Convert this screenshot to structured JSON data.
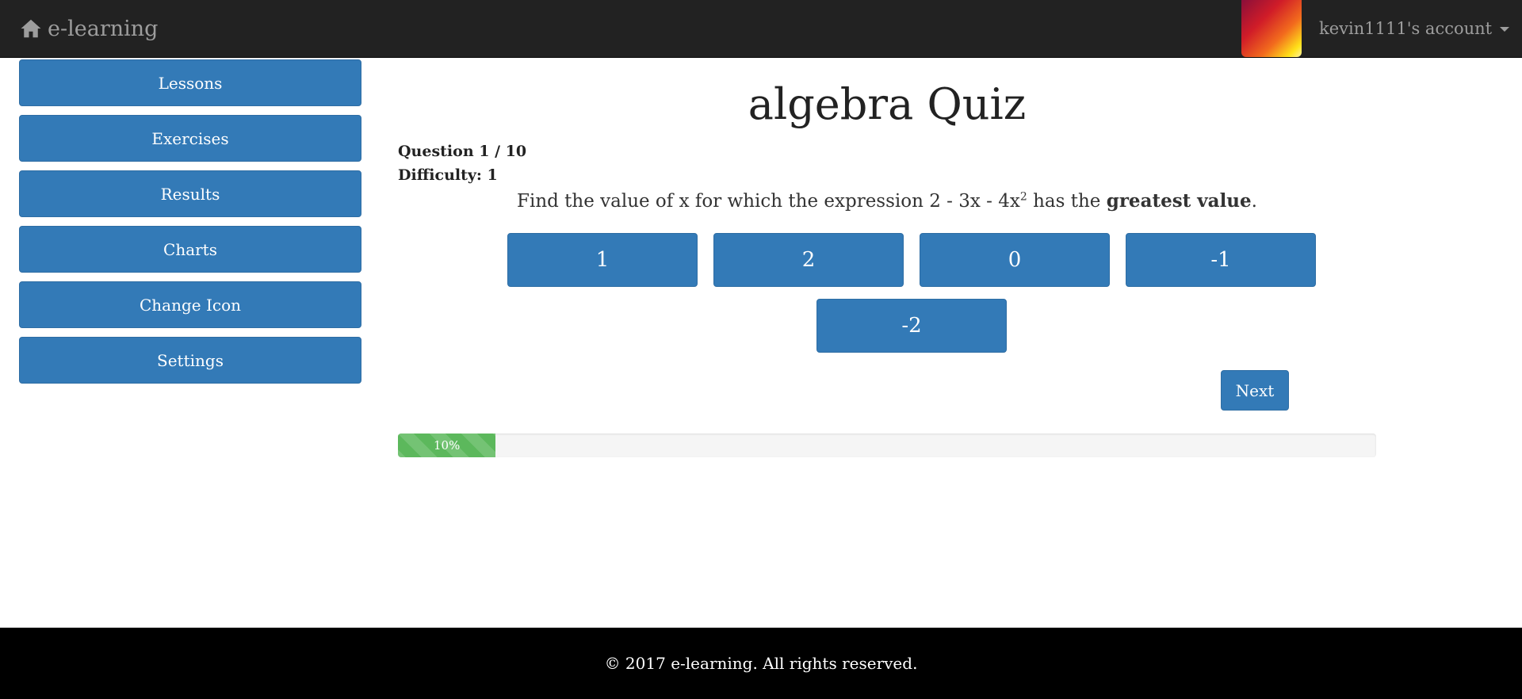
{
  "navbar": {
    "brand": "e-learning",
    "brand_icon": "home-icon",
    "account_label": "kevin1111's account",
    "colors": {
      "background": "#222222",
      "text": "#9d9d9d"
    }
  },
  "sidebar": {
    "items": [
      {
        "label": "Lessons"
      },
      {
        "label": "Exercises"
      },
      {
        "label": "Results"
      },
      {
        "label": "Charts"
      },
      {
        "label": "Change Icon"
      },
      {
        "label": "Settings"
      }
    ]
  },
  "quiz": {
    "title": "algebra Quiz",
    "question_counter": "Question 1 / 10",
    "difficulty": "Difficulty: 1",
    "question": {
      "prefix": "Find the value of x for which the expression 2 - 3x - 4x",
      "exponent": "2",
      "middle": " has the ",
      "emphasis": "greatest value",
      "suffix": "."
    },
    "answers": [
      "1",
      "2",
      "0",
      "-1",
      "-2"
    ],
    "next_label": "Next",
    "progress": {
      "percent": 10,
      "label": "10%"
    }
  },
  "footer": {
    "text": "© 2017 e-learning. All rights reserved."
  },
  "colors": {
    "primary": "#337ab7",
    "success": "#5cb85c",
    "footer": "#000000"
  }
}
